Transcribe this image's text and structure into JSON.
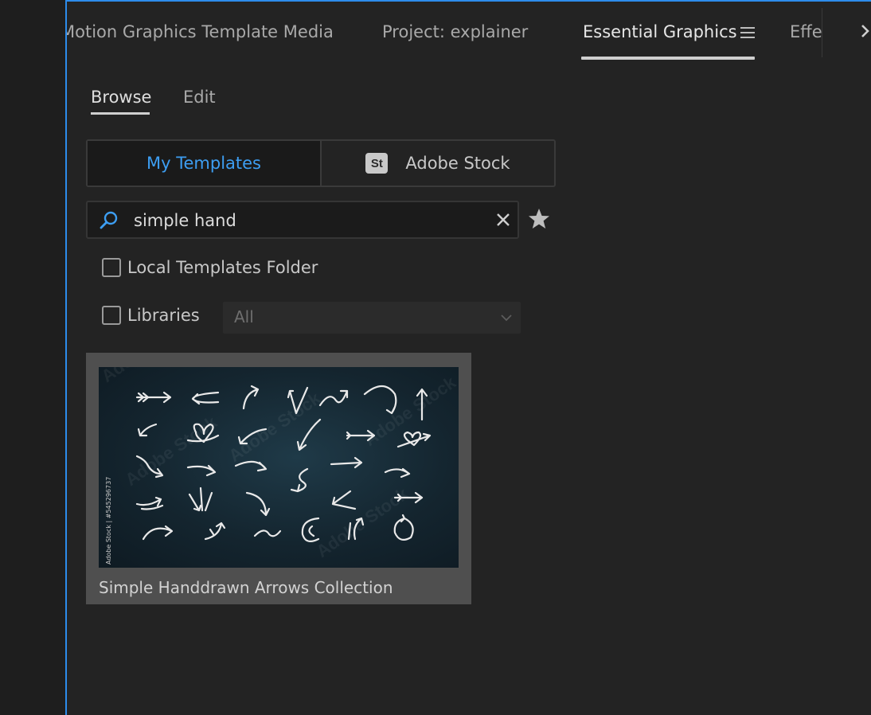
{
  "panel_tabs": [
    {
      "label": "Motion Graphics Template Media"
    },
    {
      "label": "Project: explainer"
    },
    {
      "label": "Essential Graphics"
    },
    {
      "label": "Effects"
    }
  ],
  "subtabs": {
    "browse": "Browse",
    "edit": "Edit"
  },
  "source_toggle": {
    "my_templates": "My Templates",
    "adobe_stock_badge": "St",
    "adobe_stock": "Adobe Stock"
  },
  "search": {
    "value": "simple hand",
    "placeholder": ""
  },
  "filters": {
    "local_templates_label": "Local Templates Folder",
    "libraries_label": "Libraries",
    "libraries_dropdown_value": "All"
  },
  "results": [
    {
      "title": "Simple Handdrawn Arrows Collection",
      "stock_id": "Adobe Stock | #545296737"
    }
  ],
  "colors": {
    "accent": "#3d9ef2",
    "panel_border": "#2d8ceb"
  },
  "icons": [
    "hamburger-menu-icon",
    "chevron-right-icon",
    "search-icon",
    "clear-icon",
    "star-icon",
    "chevron-down-icon"
  ]
}
